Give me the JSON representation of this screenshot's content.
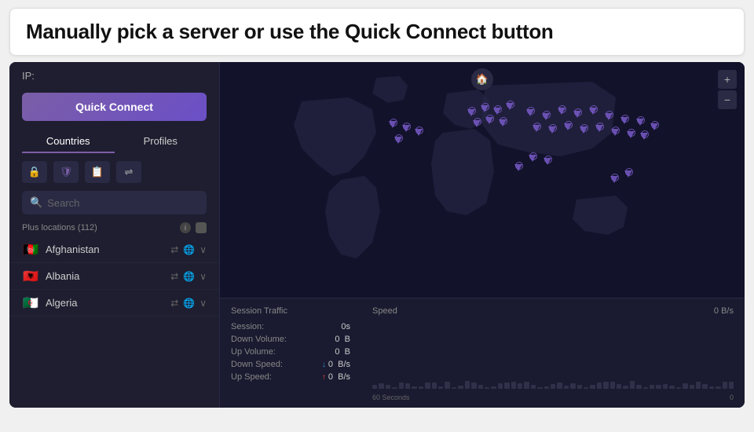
{
  "heading": {
    "text": "Manually pick a server or use the Quick Connect button"
  },
  "left_panel": {
    "ip_label": "IP:",
    "quick_connect_label": "Quick Connect",
    "tabs": [
      {
        "label": "Countries",
        "active": true
      },
      {
        "label": "Profiles",
        "active": false
      }
    ],
    "filter_icons": [
      "🔒",
      "🛡",
      "📋",
      "⇌"
    ],
    "search": {
      "placeholder": "Search",
      "value": ""
    },
    "plus_locations": {
      "label": "Plus locations (112)"
    },
    "countries": [
      {
        "name": "Afghanistan",
        "flag": "🇦🇫"
      },
      {
        "name": "Albania",
        "flag": "🇦🇱"
      },
      {
        "name": "Algeria",
        "flag": "🇩🇿"
      }
    ]
  },
  "right_panel": {
    "map_controls": {
      "plus": "+",
      "minus": "−"
    },
    "stats": {
      "title": "Session Traffic",
      "speed_title": "Speed",
      "speed_value": "0 B/s",
      "rows": [
        {
          "label": "Session:",
          "value": "0s",
          "arrow": null
        },
        {
          "label": "Down Volume:",
          "value": "0   B",
          "arrow": null
        },
        {
          "label": "Up Volume:",
          "value": "0   B",
          "arrow": null
        },
        {
          "label": "Down Speed:",
          "value": "0  B/s",
          "arrow": "down"
        },
        {
          "label": "Up Speed:",
          "value": "0  B/s",
          "arrow": "up"
        }
      ],
      "chart_labels": {
        "left": "60 Seconds",
        "right": "0"
      }
    }
  }
}
